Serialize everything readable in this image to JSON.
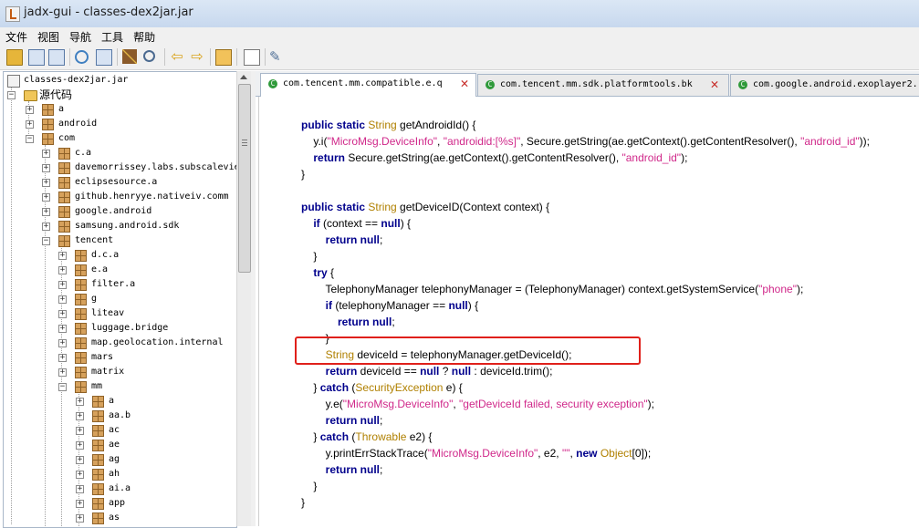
{
  "window": {
    "title": "jadx-gui - classes-dex2jar.jar"
  },
  "menu": {
    "items": [
      "文件",
      "视图",
      "导航",
      "工具",
      "帮助"
    ]
  },
  "toolbar": {
    "icons": [
      "open-folder-icon",
      "save-all-icon",
      "copy-icon",
      "sync-icon",
      "add-icon",
      "wand-icon",
      "search-icon",
      "back-icon",
      "forward-icon",
      "save-icon",
      "log-icon",
      "preferences-icon"
    ]
  },
  "tree": {
    "rows": [
      {
        "label": "classes-dex2jar.jar",
        "kind": "jar"
      },
      {
        "label": "源代码",
        "kind": "folder"
      },
      {
        "label": "a",
        "kind": "pkg"
      },
      {
        "label": "android",
        "kind": "pkg"
      },
      {
        "label": "com",
        "kind": "pkg"
      },
      {
        "label": "c.a",
        "kind": "pkg"
      },
      {
        "label": "davemorrissey.labs.subscaleview",
        "kind": "pkg"
      },
      {
        "label": "eclipsesource.a",
        "kind": "pkg"
      },
      {
        "label": "github.henryye.nativeiv.comm",
        "kind": "pkg"
      },
      {
        "label": "google.android",
        "kind": "pkg"
      },
      {
        "label": "samsung.android.sdk",
        "kind": "pkg"
      },
      {
        "label": "tencent",
        "kind": "pkg"
      },
      {
        "label": "d.c.a",
        "kind": "pkg"
      },
      {
        "label": "e.a",
        "kind": "pkg"
      },
      {
        "label": "filter.a",
        "kind": "pkg"
      },
      {
        "label": "g",
        "kind": "pkg"
      },
      {
        "label": "liteav",
        "kind": "pkg"
      },
      {
        "label": "luggage.bridge",
        "kind": "pkg"
      },
      {
        "label": "map.geolocation.internal",
        "kind": "pkg"
      },
      {
        "label": "mars",
        "kind": "pkg"
      },
      {
        "label": "matrix",
        "kind": "pkg"
      },
      {
        "label": "mm",
        "kind": "pkg"
      },
      {
        "label": "a",
        "kind": "pkg"
      },
      {
        "label": "aa.b",
        "kind": "pkg"
      },
      {
        "label": "ac",
        "kind": "pkg"
      },
      {
        "label": "ae",
        "kind": "pkg"
      },
      {
        "label": "ag",
        "kind": "pkg"
      },
      {
        "label": "ah",
        "kind": "pkg"
      },
      {
        "label": "ai.a",
        "kind": "pkg"
      },
      {
        "label": "app",
        "kind": "pkg"
      },
      {
        "label": "as",
        "kind": "pkg"
      }
    ]
  },
  "tabs": [
    {
      "label": "com.tencent.mm.compatible.e.q",
      "active": true
    },
    {
      "label": "com.tencent.mm.sdk.platformtools.bk",
      "active": false
    },
    {
      "label": "com.google.android.exoplayer2.",
      "active": false
    }
  ],
  "code": {
    "lines": [
      {
        "parts": [
          {
            "t": "public static ",
            "c": "kw"
          },
          {
            "t": "String",
            "c": "ty"
          },
          {
            "t": " getAndroidId() {",
            "c": ""
          }
        ]
      },
      {
        "parts": [
          {
            "t": "    y.i(",
            "c": ""
          },
          {
            "t": "\"MicroMsg.DeviceInfo\"",
            "c": "st"
          },
          {
            "t": ", ",
            "c": ""
          },
          {
            "t": "\"androidid:[%s]\"",
            "c": "st"
          },
          {
            "t": ", Secure.getString(ae.getContext().getContentResolver(), ",
            "c": ""
          },
          {
            "t": "\"android_id\"",
            "c": "st"
          },
          {
            "t": "));",
            "c": ""
          }
        ]
      },
      {
        "parts": [
          {
            "t": "    ",
            "c": ""
          },
          {
            "t": "return",
            "c": "kw"
          },
          {
            "t": " Secure.getString(ae.getContext().getContentResolver(), ",
            "c": ""
          },
          {
            "t": "\"android_id\"",
            "c": "st"
          },
          {
            "t": ");",
            "c": ""
          }
        ]
      },
      {
        "parts": [
          {
            "t": "}",
            "c": ""
          }
        ]
      },
      {
        "parts": []
      },
      {
        "parts": [
          {
            "t": "public static ",
            "c": "kw"
          },
          {
            "t": "String",
            "c": "ty"
          },
          {
            "t": " getDeviceID(Context context) {",
            "c": ""
          }
        ]
      },
      {
        "parts": [
          {
            "t": "    ",
            "c": ""
          },
          {
            "t": "if",
            "c": "kw"
          },
          {
            "t": " (context == ",
            "c": ""
          },
          {
            "t": "null",
            "c": "kw"
          },
          {
            "t": ") {",
            "c": ""
          }
        ]
      },
      {
        "parts": [
          {
            "t": "        ",
            "c": ""
          },
          {
            "t": "return null",
            "c": "kw"
          },
          {
            "t": ";",
            "c": ""
          }
        ]
      },
      {
        "parts": [
          {
            "t": "    }",
            "c": ""
          }
        ]
      },
      {
        "parts": [
          {
            "t": "    ",
            "c": ""
          },
          {
            "t": "try",
            "c": "kw"
          },
          {
            "t": " {",
            "c": ""
          }
        ]
      },
      {
        "parts": [
          {
            "t": "        TelephonyManager telephonyManager = (TelephonyManager) context.getSystemService(",
            "c": ""
          },
          {
            "t": "\"phone\"",
            "c": "st"
          },
          {
            "t": ");",
            "c": ""
          }
        ]
      },
      {
        "parts": [
          {
            "t": "        ",
            "c": ""
          },
          {
            "t": "if",
            "c": "kw"
          },
          {
            "t": " (telephonyManager == ",
            "c": ""
          },
          {
            "t": "null",
            "c": "kw"
          },
          {
            "t": ") {",
            "c": ""
          }
        ]
      },
      {
        "parts": [
          {
            "t": "            ",
            "c": ""
          },
          {
            "t": "return null",
            "c": "kw"
          },
          {
            "t": ";",
            "c": ""
          }
        ]
      },
      {
        "parts": [
          {
            "t": "        }",
            "c": ""
          }
        ]
      },
      {
        "parts": [
          {
            "t": "        ",
            "c": ""
          },
          {
            "t": "String",
            "c": "ty"
          },
          {
            "t": " deviceId = telephonyManager.getDeviceId();",
            "c": ""
          }
        ]
      },
      {
        "parts": [
          {
            "t": "        ",
            "c": ""
          },
          {
            "t": "return",
            "c": "kw"
          },
          {
            "t": " deviceId == ",
            "c": ""
          },
          {
            "t": "null",
            "c": "kw"
          },
          {
            "t": " ? ",
            "c": ""
          },
          {
            "t": "null",
            "c": "kw"
          },
          {
            "t": " : deviceId.trim();",
            "c": ""
          }
        ]
      },
      {
        "parts": [
          {
            "t": "    } ",
            "c": ""
          },
          {
            "t": "catch",
            "c": "kw"
          },
          {
            "t": " (",
            "c": ""
          },
          {
            "t": "SecurityException",
            "c": "ty"
          },
          {
            "t": " e) {",
            "c": ""
          }
        ]
      },
      {
        "parts": [
          {
            "t": "        y.e(",
            "c": ""
          },
          {
            "t": "\"MicroMsg.DeviceInfo\"",
            "c": "st"
          },
          {
            "t": ", ",
            "c": ""
          },
          {
            "t": "\"getDeviceId failed, security exception\"",
            "c": "st"
          },
          {
            "t": ");",
            "c": ""
          }
        ]
      },
      {
        "parts": [
          {
            "t": "        ",
            "c": ""
          },
          {
            "t": "return null",
            "c": "kw"
          },
          {
            "t": ";",
            "c": ""
          }
        ]
      },
      {
        "parts": [
          {
            "t": "    } ",
            "c": ""
          },
          {
            "t": "catch",
            "c": "kw"
          },
          {
            "t": " (",
            "c": ""
          },
          {
            "t": "Throwable",
            "c": "ty"
          },
          {
            "t": " e2) {",
            "c": ""
          }
        ]
      },
      {
        "parts": [
          {
            "t": "        y.printErrStackTrace(",
            "c": ""
          },
          {
            "t": "\"MicroMsg.DeviceInfo\"",
            "c": "st"
          },
          {
            "t": ", e2, ",
            "c": ""
          },
          {
            "t": "\"\"",
            "c": "st"
          },
          {
            "t": ", ",
            "c": ""
          },
          {
            "t": "new ",
            "c": "kw"
          },
          {
            "t": "Object",
            "c": "ty"
          },
          {
            "t": "[0]);",
            "c": ""
          }
        ]
      },
      {
        "parts": [
          {
            "t": "        ",
            "c": ""
          },
          {
            "t": "return null",
            "c": "kw"
          },
          {
            "t": ";",
            "c": ""
          }
        ]
      },
      {
        "parts": [
          {
            "t": "    }",
            "c": ""
          }
        ]
      },
      {
        "parts": [
          {
            "t": "}",
            "c": ""
          }
        ]
      }
    ],
    "highlighted_line": 14
  },
  "colors": {
    "keyword": "#00008c",
    "type": "#b08000",
    "string": "#d0288a",
    "highlight": "#e0201b",
    "class_icon": "#2f9a3a"
  }
}
